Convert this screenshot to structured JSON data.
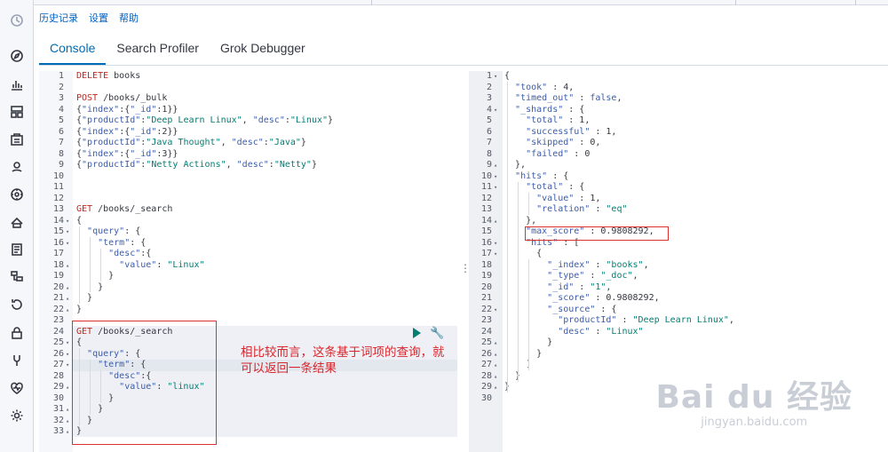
{
  "menu": {
    "history": "历史记录",
    "settings": "设置",
    "help": "帮助"
  },
  "tabs": [
    {
      "label": "Console",
      "active": true
    },
    {
      "label": "Search Profiler",
      "active": false
    },
    {
      "label": "Grok Debugger",
      "active": false
    }
  ],
  "rail_icons": [
    "clock-icon",
    "compass-icon",
    "chart-icon",
    "dashboard-icon",
    "canvas-icon",
    "map-icon",
    "ml-icon",
    "infrastructure-icon",
    "logs-icon",
    "apm-icon",
    "uptime-icon",
    "security-icon",
    "devtools-icon",
    "monitoring-icon",
    "settings-icon"
  ],
  "request_lines": [
    "DELETE books",
    "",
    "POST /books/_bulk",
    "{\"index\":{\"_id\":1}}",
    "{\"productId\":\"Deep Learn Linux\", \"desc\":\"Linux\"}",
    "{\"index\":{\"_id\":2}}",
    "{\"productId\":\"Java Thought\", \"desc\":\"Java\"}",
    "{\"index\":{\"_id\":3}}",
    "{\"productId\":\"Netty Actions\", \"desc\":\"Netty\"}",
    "",
    "",
    "",
    "GET /books/_search",
    "{",
    "  \"query\": {",
    "    \"term\": {",
    "      \"desc\":{",
    "        \"value\": \"Linux\"",
    "      }",
    "    }",
    "  }",
    "}",
    "",
    "GET /books/_search",
    "{",
    "  \"query\": {",
    "    \"term\": {",
    "      \"desc\":{",
    "        \"value\": \"linux\"",
    "      }",
    "    }",
    "  }",
    "}"
  ],
  "response_lines": [
    "{",
    "  \"took\" : 4,",
    "  \"timed_out\" : false,",
    "  \"_shards\" : {",
    "    \"total\" : 1,",
    "    \"successful\" : 1,",
    "    \"skipped\" : 0,",
    "    \"failed\" : 0",
    "  },",
    "  \"hits\" : {",
    "    \"total\" : {",
    "      \"value\" : 1,",
    "      \"relation\" : \"eq\"",
    "    },",
    "    \"max_score\" : 0.9808292,",
    "    \"hits\" : [",
    "      {",
    "        \"_index\" : \"books\",",
    "        \"_type\" : \"_doc\",",
    "        \"_id\" : \"1\",",
    "        \"_score\" : 0.9808292,",
    "        \"_source\" : {",
    "          \"productId\" : \"Deep Learn Linux\",",
    "          \"desc\" : \"Linux\"",
    "        }",
    "      }",
    "    ]",
    "  }",
    "}",
    ""
  ],
  "annotation": "相比较而言，这条基于词项的查询，就可以返回一条结果",
  "watermark": {
    "brand": "Bai du 经验",
    "url": "jingyan.baidu.com"
  },
  "colors": {
    "accent": "#006bb4",
    "method": "#bd271e",
    "string": "#017d73",
    "annotation_red": "#e0302e"
  }
}
